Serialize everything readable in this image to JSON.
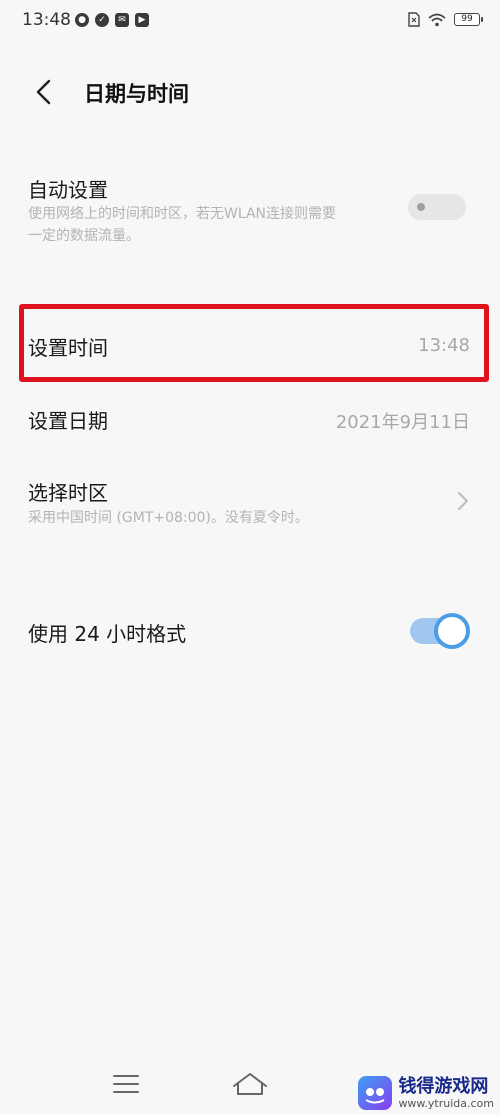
{
  "status_bar": {
    "time": "13:48",
    "battery": "99"
  },
  "header": {
    "title": "日期与时间"
  },
  "settings": {
    "auto_set": {
      "title": "自动设置",
      "subtitle_line1": "使用网络上的时间和时区，若无WLAN连接则需要",
      "subtitle_line2": "一定的数据流量。",
      "enabled": false
    },
    "set_time": {
      "title": "设置时间",
      "value": "13:48"
    },
    "set_date": {
      "title": "设置日期",
      "value": "2021年9月11日"
    },
    "timezone": {
      "title": "选择时区",
      "subtitle": "采用中国时间 (GMT+08:00)。没有夏令时。"
    },
    "hour24": {
      "title": "使用 24 小时格式",
      "enabled": true
    }
  },
  "colors": {
    "highlight": "#e0121e",
    "toggle_on": "#4a9ee6",
    "background": "#f7f7f7"
  },
  "watermark": {
    "name": "钱得游戏网",
    "url": "www.ytruida.com"
  }
}
